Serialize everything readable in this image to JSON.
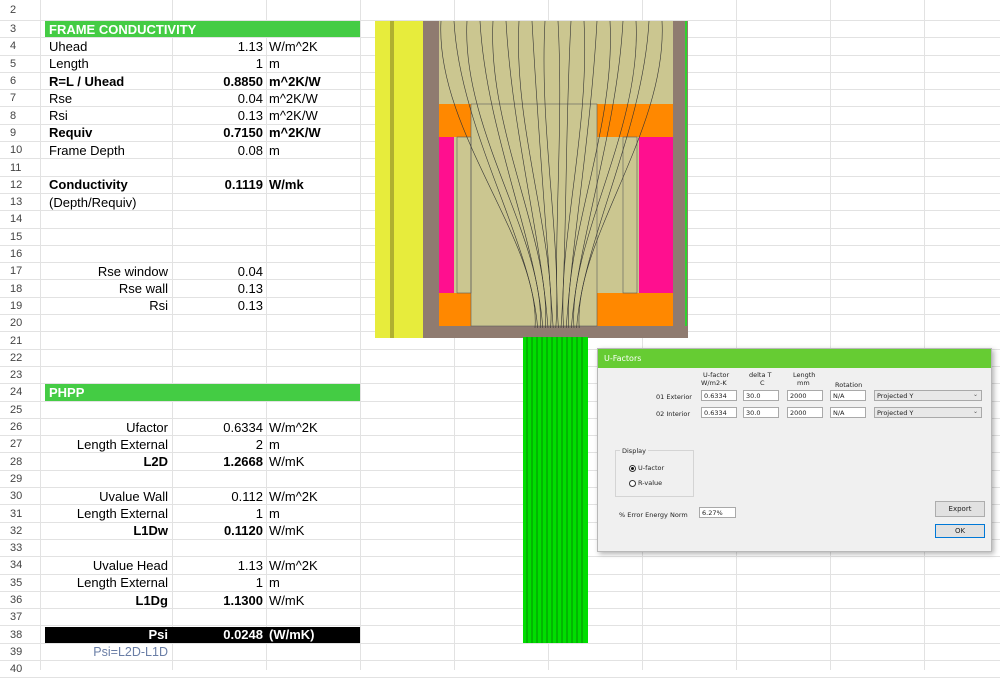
{
  "sheet": {
    "rows": [
      {
        "n": "2"
      },
      {
        "n": "3",
        "band": "#44cc44",
        "b": "FRAME CONDUCTIVITY",
        "bClass": "hdr"
      },
      {
        "n": "4",
        "b": "Uhead",
        "c": "1.13",
        "d": "W/m^2K"
      },
      {
        "n": "5",
        "b": "Length",
        "c": "1",
        "d": "m"
      },
      {
        "n": "6",
        "b": "R=L / Uhead",
        "c": "0.8850",
        "d": "m^2K/W",
        "bold": true
      },
      {
        "n": "7",
        "b": "Rse",
        "c": "0.04",
        "d": "m^2K/W"
      },
      {
        "n": "8",
        "b": "Rsi",
        "c": "0.13",
        "d": "m^2K/W"
      },
      {
        "n": "9",
        "b": "Requiv",
        "c": "0.7150",
        "d": "m^2K/W",
        "bold": true
      },
      {
        "n": "10",
        "b": "Frame Depth",
        "c": "0.08",
        "d": "m"
      },
      {
        "n": "11"
      },
      {
        "n": "12",
        "b": "Conductivity",
        "c": "0.1119",
        "d": "W/mk",
        "bold": true
      },
      {
        "n": "13",
        "b": "(Depth/Requiv)"
      },
      {
        "n": "14"
      },
      {
        "n": "15"
      },
      {
        "n": "16"
      },
      {
        "n": "17",
        "b": "Rse window",
        "c": "0.04",
        "right": true
      },
      {
        "n": "18",
        "b": "Rse wall",
        "c": "0.13",
        "right": true
      },
      {
        "n": "19",
        "b": "Rsi",
        "c": "0.13",
        "right": true
      },
      {
        "n": "20"
      },
      {
        "n": "21"
      },
      {
        "n": "22"
      },
      {
        "n": "23"
      },
      {
        "n": "24",
        "band": "#44cc44",
        "b": "PHPP",
        "bClass": "hdr"
      },
      {
        "n": "25"
      },
      {
        "n": "26",
        "b": "Ufactor",
        "c": "0.6334",
        "d": "W/m^2K",
        "right": true
      },
      {
        "n": "27",
        "b": "Length External",
        "c": "2",
        "d": "m",
        "right": true
      },
      {
        "n": "28",
        "b": "L2D",
        "c": "1.2668",
        "d": "W/mK",
        "right": true,
        "bold": true,
        "dPlain": true
      },
      {
        "n": "29"
      },
      {
        "n": "30",
        "b": "Uvalue Wall",
        "c": "0.112",
        "d": "W/m^2K",
        "right": true
      },
      {
        "n": "31",
        "b": "Length External",
        "c": "1",
        "d": "m",
        "right": true
      },
      {
        "n": "32",
        "b": "L1Dw",
        "c": "0.1120",
        "d": "W/mK",
        "right": true,
        "bold": true,
        "dPlain": true
      },
      {
        "n": "33"
      },
      {
        "n": "34",
        "b": "Uvalue Head",
        "c": "1.13",
        "d": "W/m^2K",
        "right": true
      },
      {
        "n": "35",
        "b": "Length External",
        "c": "1",
        "d": "m",
        "right": true
      },
      {
        "n": "36",
        "b": "L1Dg",
        "c": "1.1300",
        "d": "W/mK",
        "right": true,
        "bold": true,
        "dPlain": true
      },
      {
        "n": "37"
      },
      {
        "n": "38",
        "band": "#000000",
        "b": "Psi",
        "c": "0.0248",
        "d": "(W/mK)",
        "right": true,
        "psi": true
      },
      {
        "n": "39",
        "b": "Psi=L2D-L1D",
        "right": true,
        "note": true
      },
      {
        "n": "40"
      }
    ]
  },
  "dialog": {
    "title": "U-Factors",
    "col_ufactor": "U-factor",
    "col_ufactor_unit": "W/m2-K",
    "col_deltat": "delta T",
    "col_deltat_unit": "C",
    "col_length": "Length",
    "col_length_unit": "mm",
    "col_rotation": "Rotation",
    "rows": [
      {
        "label": "01 Exterior",
        "ufactor": "0.6334",
        "deltat": "30.0",
        "length": "2000",
        "rotation": "N/A",
        "projection": "Projected Y"
      },
      {
        "label": "02 Interior",
        "ufactor": "0.6334",
        "deltat": "30.0",
        "length": "2000",
        "rotation": "N/A",
        "projection": "Projected Y"
      }
    ],
    "display_label": "Display",
    "opt_ufactor": "U-factor",
    "opt_rvalue": "R-value",
    "error_label": "% Error Energy Norm",
    "error_value": "6.27%",
    "export_label": "Export",
    "ok_label": "OK"
  },
  "colors": {
    "header_band": "#44cc44",
    "psi_band": "#000000",
    "dialog_title": "#66cc33",
    "fluid_green": "#00dd00",
    "frame_fill": "#cbc690",
    "glass_yellow": "#e7ec3c",
    "insulation_orange": "#ff8800",
    "seal_magenta": "#ff0f8f"
  }
}
